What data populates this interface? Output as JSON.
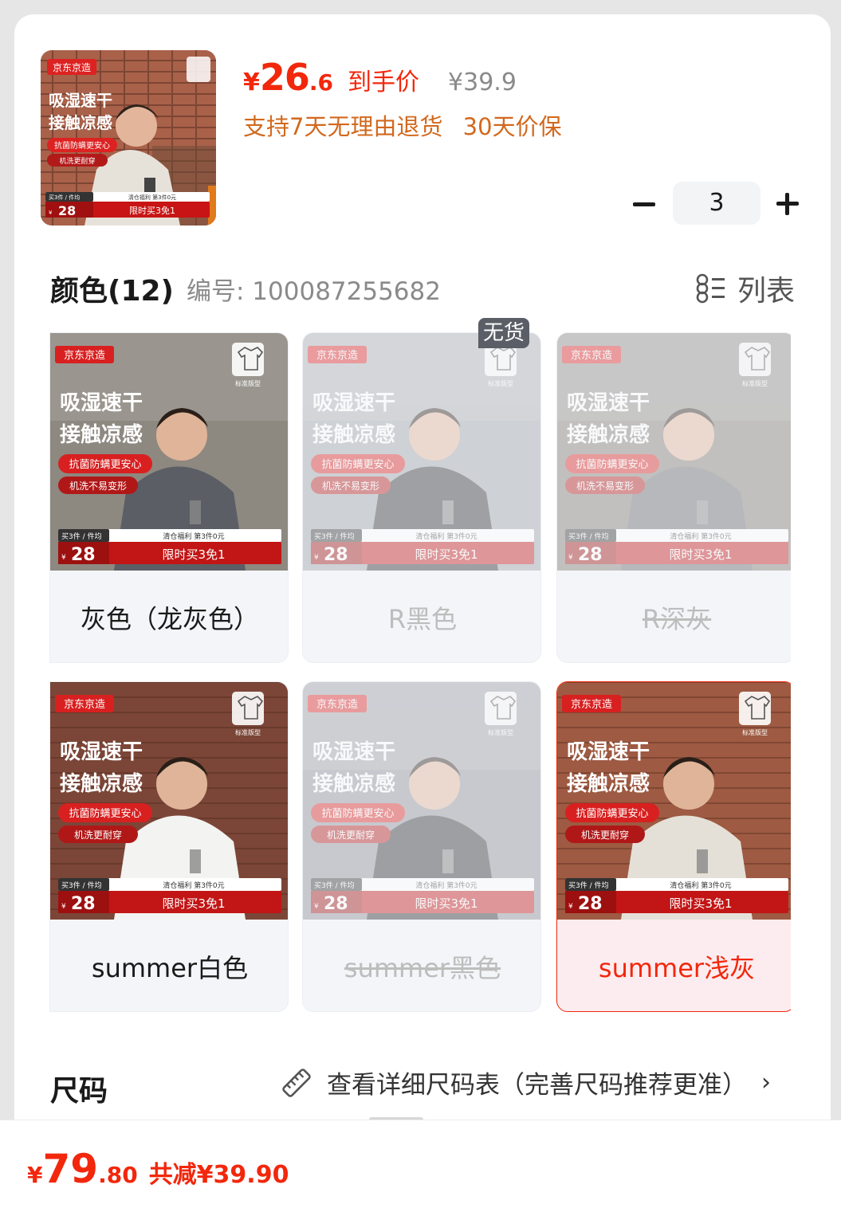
{
  "product": {
    "price_currency": "¥",
    "price_integer": "26",
    "price_decimal": ".6",
    "price_tag": "到手价",
    "original_price": "¥39.9",
    "promises": [
      "支持7天无理由退货",
      "30天价保"
    ],
    "quantity": "3"
  },
  "promo_image": {
    "brand": "京东京造",
    "headline_1": "吸湿速干",
    "headline_2": "接触凉感",
    "feature_1": "抗菌防螨更安心",
    "feature_2a": "机洗不易变形",
    "feature_2b": "机洗更耐穿",
    "fit_label": "标准版型",
    "clearance_badge": "清仓",
    "deal_top_left": "买3件 / 件均",
    "deal_top_right": "清仓福利  第3件0元",
    "deal_currency": "¥",
    "deal_price": "28",
    "deal_bottom": "限时买3免1"
  },
  "colors": {
    "title": "颜色(12)",
    "sku_label": "编号: 100087255682",
    "view_toggle_label": "列表",
    "out_of_stock_label": "无货",
    "options": [
      {
        "name": "灰色（龙灰色）",
        "state": "normal",
        "shirt": "#5b5e64"
      },
      {
        "name": "R黑色",
        "state": "unavailable",
        "shirt": "#2b2c30"
      },
      {
        "name": "R深灰",
        "state": "unavailable",
        "shirt": "#62656b"
      },
      {
        "name": "summer白色",
        "state": "normal",
        "shirt": "#f3f3f1"
      },
      {
        "name": "summer黑色",
        "state": "unavailable",
        "shirt": "#2a2b2e"
      },
      {
        "name": "summer浅灰",
        "state": "selected",
        "shirt": "#e4e0d8"
      }
    ]
  },
  "size": {
    "title": "尺码",
    "chart_link": "查看详细尺码表（完善尺码推荐更准）",
    "chevron": "›"
  },
  "footer": {
    "currency": "¥",
    "total_integer": "79",
    "total_decimal": ".80",
    "savings": "共减¥39.90"
  },
  "colors_theme": {
    "accent_red": "#f2270c",
    "promise_orange": "#d2691e",
    "selected_bg": "#fdecef"
  }
}
